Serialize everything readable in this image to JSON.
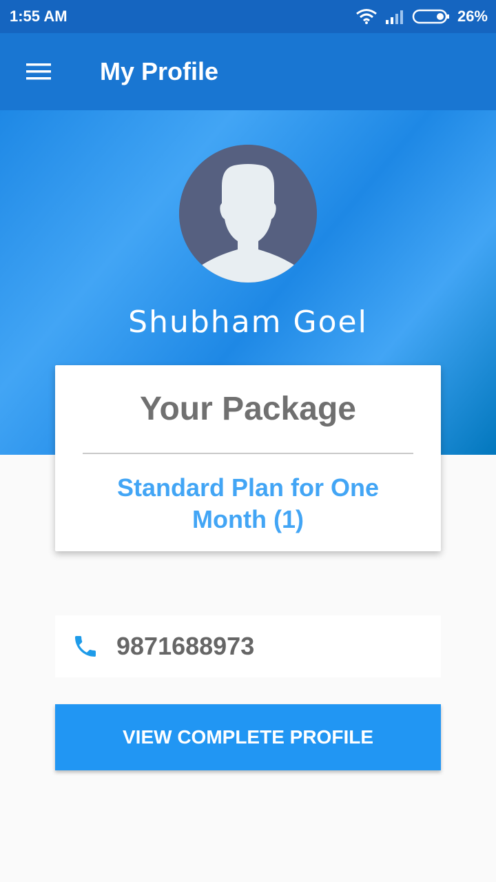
{
  "status_bar": {
    "time": "1:55 AM",
    "battery": "26%",
    "icons": [
      "wifi-icon",
      "signal-icon",
      "battery-icon"
    ]
  },
  "app_bar": {
    "title": "My Profile",
    "menu_icon": "hamburger-menu-icon"
  },
  "profile": {
    "name": "Shubham Goel",
    "avatar_icon": "default-avatar-icon"
  },
  "package": {
    "title": "Your Package",
    "plan": "Standard Plan for One Month (1)"
  },
  "contact": {
    "phone": "9871688973",
    "icon": "phone-icon"
  },
  "actions": {
    "view_profile_label": "VIEW COMPLETE PROFILE"
  },
  "colors": {
    "status_bar": "#1565c0",
    "app_bar": "#1976d2",
    "accent": "#2196f3",
    "plan_text": "#42a5f5"
  }
}
